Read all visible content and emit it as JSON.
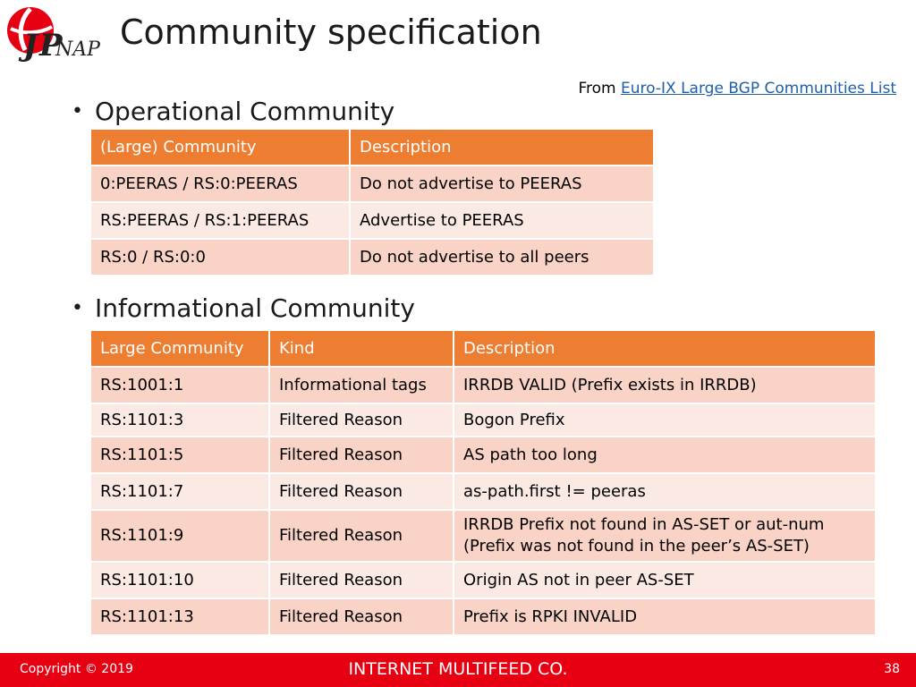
{
  "header": {
    "logo_text": "JPNAP",
    "title": "Community specification"
  },
  "source": {
    "prefix": "From",
    "link_text": "Euro-IX Large BGP Communities List"
  },
  "sections": [
    {
      "bullet": "Operational Community",
      "columns": [
        "(Large) Community",
        "Description"
      ],
      "rows": [
        [
          "0:PEERAS / RS:0:PEERAS",
          "Do not advertise to PEERAS"
        ],
        [
          "RS:PEERAS / RS:1:PEERAS",
          "Advertise to PEERAS"
        ],
        [
          "RS:0 / RS:0:0",
          "Do not advertise to all peers"
        ]
      ]
    },
    {
      "bullet": "Informational Community",
      "columns": [
        "Large Community",
        "Kind",
        "Description"
      ],
      "rows": [
        [
          "RS:1001:1",
          "Informational tags",
          "IRRDB VALID (Prefix exists in IRRDB)"
        ],
        [
          "RS:1101:3",
          "Filtered Reason",
          "Bogon Prefix"
        ],
        [
          "RS:1101:5",
          "Filtered Reason",
          "AS path too long"
        ],
        [
          "RS:1101:7",
          "Filtered Reason",
          "as-path.first != peeras"
        ],
        [
          "RS:1101:9",
          "Filtered Reason",
          "IRRDB Prefix not found in AS-SET or aut-num (Prefix was not found in the peer’s AS-SET)"
        ],
        [
          "RS:1101:10",
          "Filtered Reason",
          "Origin AS not in peer AS-SET"
        ],
        [
          "RS:1101:13",
          "Filtered Reason",
          "Prefix is RPKI INVALID"
        ]
      ]
    }
  ],
  "footer": {
    "copyright": "Copyright © 2019",
    "company": "INTERNET MULTIFEED CO.",
    "page_number": "38"
  },
  "colors": {
    "header_fill": "#ed7d31",
    "row_dark": "#f8d3c6",
    "row_light": "#fbe9e4",
    "footer_bar": "#e60012",
    "link": "#1f5fa8"
  }
}
